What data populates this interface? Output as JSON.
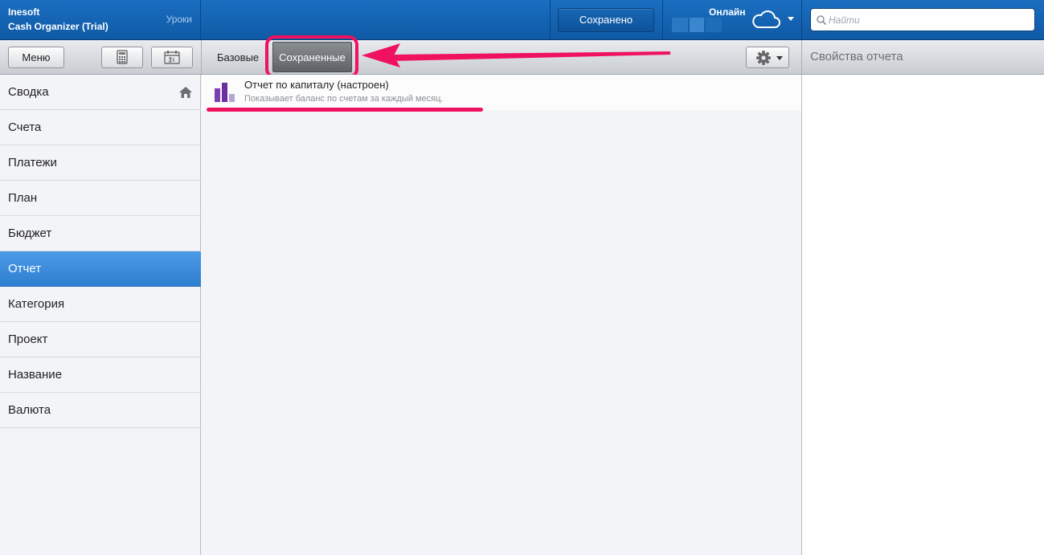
{
  "app": {
    "company": "Inesoft",
    "name": "Cash Organizer (Trial)",
    "lessons_link": "Уроки"
  },
  "header": {
    "saved_button": "Сохранено",
    "online_label": "Онлайн",
    "search": {
      "placeholder": "Найти",
      "value": ""
    }
  },
  "toolbar": {
    "menu_button": "Меню",
    "tabs": [
      {
        "label": "Базовые",
        "selected": false
      },
      {
        "label": "Сохраненные",
        "selected": true
      }
    ],
    "properties_title": "Свойства отчета"
  },
  "sidebar": {
    "items": [
      {
        "label": "Сводка",
        "active": false
      },
      {
        "label": "Счета",
        "active": false
      },
      {
        "label": "Платежи",
        "active": false
      },
      {
        "label": "План",
        "active": false
      },
      {
        "label": "Бюджет",
        "active": false
      },
      {
        "label": "Отчет",
        "active": true
      },
      {
        "label": "Категория",
        "active": false
      },
      {
        "label": "Проект",
        "active": false
      },
      {
        "label": "Название",
        "active": false
      },
      {
        "label": "Валюта",
        "active": false
      }
    ]
  },
  "reports": [
    {
      "title": "Отчет по капиталу (настроен)",
      "description": "Показывает баланс по счетам за каждый месяц."
    }
  ],
  "colors": {
    "header_blue": "#1a6ec0",
    "active_item": "#3a8ad9",
    "annotation": "#f0115f",
    "report_icon": "#7b3fb0"
  }
}
